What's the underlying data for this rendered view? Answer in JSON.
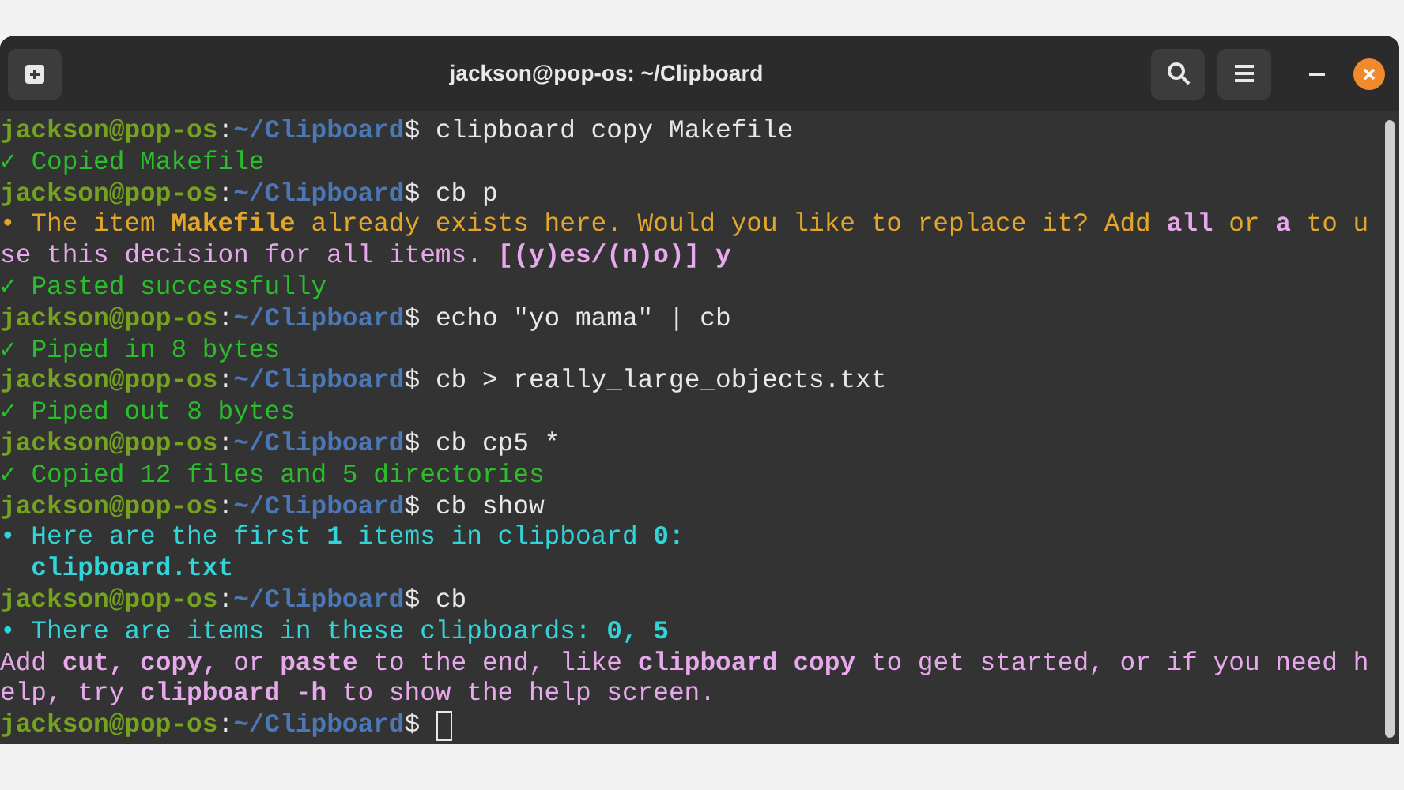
{
  "window": {
    "title": "jackson@pop-os: ~/Clipboard"
  },
  "lines": [
    {
      "cursor": false,
      "segments": [
        {
          "text": "jackson@pop-os",
          "color": "#75a31f",
          "bold": true
        },
        {
          "text": ":",
          "color": "#e8e8e8",
          "bold": false
        },
        {
          "text": "~/Clipboard",
          "color": "#4b78b5",
          "bold": true
        },
        {
          "text": "$ clipboard copy Makefile",
          "color": "#e8e8e8",
          "bold": false
        }
      ]
    },
    {
      "cursor": false,
      "segments": [
        {
          "text": "✓ Copied Makefile",
          "color": "#2bbd2b",
          "bold": false
        }
      ]
    },
    {
      "cursor": false,
      "segments": [
        {
          "text": "jackson@pop-os",
          "color": "#75a31f",
          "bold": true
        },
        {
          "text": ":",
          "color": "#e8e8e8",
          "bold": false
        },
        {
          "text": "~/Clipboard",
          "color": "#4b78b5",
          "bold": true
        },
        {
          "text": "$ cb p",
          "color": "#e8e8e8",
          "bold": false
        }
      ]
    },
    {
      "cursor": false,
      "segments": [
        {
          "text": "• The item ",
          "color": "#e2a72a",
          "bold": false
        },
        {
          "text": "Makefile",
          "color": "#e2a72a",
          "bold": true
        },
        {
          "text": " already exists here. Would you like to replace it? Add ",
          "color": "#e2a72a",
          "bold": false
        },
        {
          "text": "all",
          "color": "#e7a8ec",
          "bold": true
        },
        {
          "text": " or ",
          "color": "#e2a72a",
          "bold": false
        },
        {
          "text": "a",
          "color": "#e7a8ec",
          "bold": true
        },
        {
          "text": " to u",
          "color": "#e2a72a",
          "bold": false
        }
      ]
    },
    {
      "cursor": false,
      "segments": [
        {
          "text": "se this decision for all items. ",
          "color": "#e7a8ec",
          "bold": false
        },
        {
          "text": "[(y)es/(n)o)] y",
          "color": "#e7a8ec",
          "bold": true
        }
      ]
    },
    {
      "cursor": false,
      "segments": [
        {
          "text": "✓ Pasted successfully",
          "color": "#2bbd2b",
          "bold": false
        }
      ]
    },
    {
      "cursor": false,
      "segments": [
        {
          "text": "jackson@pop-os",
          "color": "#75a31f",
          "bold": true
        },
        {
          "text": ":",
          "color": "#e8e8e8",
          "bold": false
        },
        {
          "text": "~/Clipboard",
          "color": "#4b78b5",
          "bold": true
        },
        {
          "text": "$ echo \"yo mama\" | cb",
          "color": "#e8e8e8",
          "bold": false
        }
      ]
    },
    {
      "cursor": false,
      "segments": [
        {
          "text": "✓ Piped in 8 bytes",
          "color": "#2bbd2b",
          "bold": false
        }
      ]
    },
    {
      "cursor": false,
      "segments": [
        {
          "text": "jackson@pop-os",
          "color": "#75a31f",
          "bold": true
        },
        {
          "text": ":",
          "color": "#e8e8e8",
          "bold": false
        },
        {
          "text": "~/Clipboard",
          "color": "#4b78b5",
          "bold": true
        },
        {
          "text": "$ cb > really_large_objects.txt",
          "color": "#e8e8e8",
          "bold": false
        }
      ]
    },
    {
      "cursor": false,
      "segments": [
        {
          "text": "✓ Piped out 8 bytes",
          "color": "#2bbd2b",
          "bold": false
        }
      ]
    },
    {
      "cursor": false,
      "segments": [
        {
          "text": "jackson@pop-os",
          "color": "#75a31f",
          "bold": true
        },
        {
          "text": ":",
          "color": "#e8e8e8",
          "bold": false
        },
        {
          "text": "~/Clipboard",
          "color": "#4b78b5",
          "bold": true
        },
        {
          "text": "$ cb cp5 *",
          "color": "#e8e8e8",
          "bold": false
        }
      ]
    },
    {
      "cursor": false,
      "segments": [
        {
          "text": "✓ Copied 12 files and 5 directories",
          "color": "#2bbd2b",
          "bold": false
        }
      ]
    },
    {
      "cursor": false,
      "segments": [
        {
          "text": "jackson@pop-os",
          "color": "#75a31f",
          "bold": true
        },
        {
          "text": ":",
          "color": "#e8e8e8",
          "bold": false
        },
        {
          "text": "~/Clipboard",
          "color": "#4b78b5",
          "bold": true
        },
        {
          "text": "$ cb show",
          "color": "#e8e8e8",
          "bold": false
        }
      ]
    },
    {
      "cursor": false,
      "segments": [
        {
          "text": "• Here are the first ",
          "color": "#31d4d8",
          "bold": false
        },
        {
          "text": "1",
          "color": "#31d4d8",
          "bold": true
        },
        {
          "text": " items in clipboard ",
          "color": "#31d4d8",
          "bold": false
        },
        {
          "text": "0:",
          "color": "#31d4d8",
          "bold": true
        }
      ]
    },
    {
      "cursor": false,
      "segments": [
        {
          "text": "  clipboard.txt",
          "color": "#31d4d8",
          "bold": true
        }
      ]
    },
    {
      "cursor": false,
      "segments": [
        {
          "text": "jackson@pop-os",
          "color": "#75a31f",
          "bold": true
        },
        {
          "text": ":",
          "color": "#e8e8e8",
          "bold": false
        },
        {
          "text": "~/Clipboard",
          "color": "#4b78b5",
          "bold": true
        },
        {
          "text": "$ cb",
          "color": "#e8e8e8",
          "bold": false
        }
      ]
    },
    {
      "cursor": false,
      "segments": [
        {
          "text": "• There are items in these clipboards: ",
          "color": "#31d4d8",
          "bold": false
        },
        {
          "text": "0, 5",
          "color": "#31d4d8",
          "bold": true
        }
      ]
    },
    {
      "cursor": false,
      "segments": [
        {
          "text": "Add ",
          "color": "#e7a8ec",
          "bold": false
        },
        {
          "text": "cut, copy,",
          "color": "#e7a8ec",
          "bold": true
        },
        {
          "text": " or ",
          "color": "#e7a8ec",
          "bold": false
        },
        {
          "text": "paste",
          "color": "#e7a8ec",
          "bold": true
        },
        {
          "text": " to the end, like ",
          "color": "#e7a8ec",
          "bold": false
        },
        {
          "text": "clipboard copy",
          "color": "#e7a8ec",
          "bold": true
        },
        {
          "text": " to get started, or if you need h",
          "color": "#e7a8ec",
          "bold": false
        }
      ]
    },
    {
      "cursor": false,
      "segments": [
        {
          "text": "elp, try ",
          "color": "#e7a8ec",
          "bold": false
        },
        {
          "text": "clipboard -h",
          "color": "#e7a8ec",
          "bold": true
        },
        {
          "text": " to show the help screen.",
          "color": "#e7a8ec",
          "bold": false
        }
      ]
    },
    {
      "cursor": true,
      "segments": [
        {
          "text": "jackson@pop-os",
          "color": "#75a31f",
          "bold": true
        },
        {
          "text": ":",
          "color": "#e8e8e8",
          "bold": false
        },
        {
          "text": "~/Clipboard",
          "color": "#4b78b5",
          "bold": true
        },
        {
          "text": "$",
          "color": "#e8e8e8",
          "bold": false
        }
      ]
    }
  ]
}
